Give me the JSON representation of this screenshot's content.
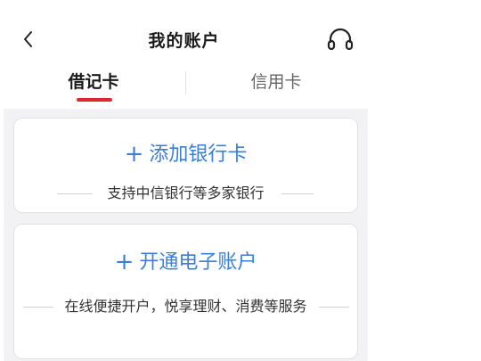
{
  "corner_marker": "2",
  "header": {
    "back_glyph": "‹",
    "title": "我的账户",
    "service_icon": "headset-icon"
  },
  "tabs": [
    {
      "label": "借记卡",
      "active": true
    },
    {
      "label": "信用卡",
      "active": false
    }
  ],
  "cards": {
    "add_card": {
      "plus": "+",
      "label": "添加银行卡",
      "subtitle": "支持中信银行等多家银行"
    },
    "open_account": {
      "plus": "+",
      "label": "开通电子账户",
      "subtitle": "在线便捷开户，悦享理财、消费等服务"
    }
  },
  "colors": {
    "accent_blue": "#3b7fd4",
    "tab_indicator_red": "#e0262e",
    "content_background": "#f2f2f4"
  }
}
